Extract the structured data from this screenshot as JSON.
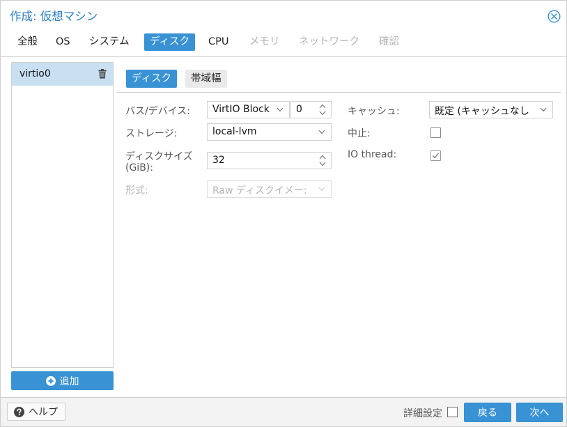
{
  "window": {
    "title": "作成: 仮想マシン"
  },
  "tabs": [
    {
      "label": "全般",
      "state": "normal"
    },
    {
      "label": "OS",
      "state": "normal"
    },
    {
      "label": "システム",
      "state": "normal"
    },
    {
      "label": "ディスク",
      "state": "active"
    },
    {
      "label": "CPU",
      "state": "normal"
    },
    {
      "label": "メモリ",
      "state": "disabled"
    },
    {
      "label": "ネットワーク",
      "state": "disabled"
    },
    {
      "label": "確認",
      "state": "disabled"
    }
  ],
  "disk_list": {
    "items": [
      {
        "label": "virtio0",
        "selected": true
      }
    ],
    "add_label": "追加"
  },
  "subtabs": [
    {
      "label": "ディスク",
      "active": true
    },
    {
      "label": "帯域幅",
      "active": false
    }
  ],
  "form": {
    "bus_device": {
      "label": "バス/デバイス:",
      "bus": "VirtIO Block",
      "device_index": "0"
    },
    "storage": {
      "label": "ストレージ:",
      "value": "local-lvm"
    },
    "disk_size": {
      "label_line1": "ディスクサイズ",
      "label_line2": "(GiB):",
      "value": "32"
    },
    "format": {
      "label": "形式:",
      "value": "Raw ディスクイメー:",
      "disabled": true
    },
    "cache": {
      "label": "キャッシュ:",
      "value": "既定 (キャッシュなし"
    },
    "discard": {
      "label": "中止:",
      "checked": false
    },
    "io_thread": {
      "label": "IO thread:",
      "checked": true
    }
  },
  "footer": {
    "help_label": "ヘルプ",
    "advanced_label": "詳細設定",
    "advanced_checked": false,
    "back_label": "戻る",
    "next_label": "次へ"
  },
  "colors": {
    "accent": "#3892d4",
    "title": "#2b7cc5",
    "selected_row": "#c9e0f3",
    "disabled_text": "#b4b4b4"
  },
  "icons": {
    "close": "close-circle-icon",
    "trash": "trash-icon",
    "add": "plus-circle-icon",
    "help": "question-circle-icon",
    "dropdown": "chevron-down-icon",
    "spinner": "spinner-arrows-icon"
  }
}
